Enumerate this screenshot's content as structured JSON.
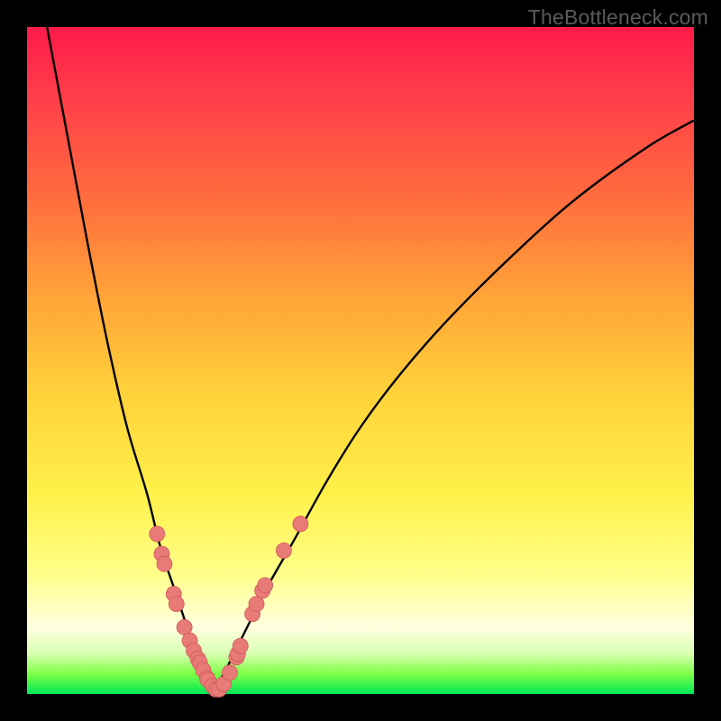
{
  "watermark": "TheBottleneck.com",
  "accent_colors": {
    "gradient_top": "#ff1a4a",
    "gradient_bottom": "#00e858",
    "curve": "#000000",
    "marker_fill": "#e87a78",
    "marker_stroke": "#d05a58"
  },
  "chart_data": {
    "type": "line",
    "title": "",
    "xlabel": "",
    "ylabel": "",
    "xlim": [
      0,
      100
    ],
    "ylim": [
      0,
      100
    ],
    "series": [
      {
        "name": "left-curve",
        "x": [
          3,
          6,
          9,
          12,
          15,
          18,
          20,
          22,
          24,
          25,
          26,
          27,
          28
        ],
        "y": [
          100,
          84,
          68,
          53,
          40,
          30,
          22,
          16,
          10,
          7,
          4,
          2,
          0.5
        ]
      },
      {
        "name": "right-curve",
        "x": [
          28,
          30,
          33,
          36,
          40,
          45,
          50,
          56,
          63,
          72,
          82,
          93,
          100
        ],
        "y": [
          0.5,
          4,
          10,
          16,
          23,
          32,
          40,
          48,
          56,
          65,
          74,
          82,
          86
        ]
      }
    ],
    "markers": {
      "name": "highlight-points",
      "points": [
        {
          "x": 19.5,
          "y": 24
        },
        {
          "x": 20.2,
          "y": 21
        },
        {
          "x": 20.6,
          "y": 19.5
        },
        {
          "x": 22.0,
          "y": 15
        },
        {
          "x": 22.4,
          "y": 13.5
        },
        {
          "x": 23.6,
          "y": 10
        },
        {
          "x": 24.4,
          "y": 8
        },
        {
          "x": 25.0,
          "y": 6.5
        },
        {
          "x": 25.6,
          "y": 5.3
        },
        {
          "x": 25.9,
          "y": 4.7
        },
        {
          "x": 26.4,
          "y": 3.6
        },
        {
          "x": 27.0,
          "y": 2.4
        },
        {
          "x": 27.1,
          "y": 2.1
        },
        {
          "x": 27.8,
          "y": 1.2
        },
        {
          "x": 28.3,
          "y": 0.7
        },
        {
          "x": 28.8,
          "y": 0.7
        },
        {
          "x": 29.5,
          "y": 1.5
        },
        {
          "x": 30.4,
          "y": 3.2
        },
        {
          "x": 31.4,
          "y": 5.5
        },
        {
          "x": 31.6,
          "y": 6.0
        },
        {
          "x": 32.0,
          "y": 7.2
        },
        {
          "x": 33.8,
          "y": 12
        },
        {
          "x": 34.4,
          "y": 13.5
        },
        {
          "x": 35.3,
          "y": 15.5
        },
        {
          "x": 35.7,
          "y": 16.3
        },
        {
          "x": 38.5,
          "y": 21.5
        },
        {
          "x": 41.0,
          "y": 25.5
        }
      ]
    }
  }
}
